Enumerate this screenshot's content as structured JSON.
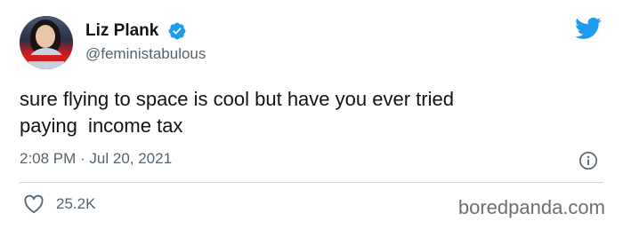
{
  "user": {
    "display_name": "Liz Plank",
    "handle": "@feministabulous",
    "verified_icon": "verified-badge-icon"
  },
  "tweet": {
    "text": "sure flying to space is cool but have you ever tried\npaying  income tax",
    "time": "2:08 PM",
    "separator": " · ",
    "date": "Jul 20, 2021",
    "likes": "25.2K"
  },
  "icons": {
    "logo": "twitter-bird-icon",
    "info": "info-icon",
    "like": "heart-icon"
  },
  "colors": {
    "twitter_blue": "#1d9bf0",
    "text": "#0f1419",
    "secondary": "#536471"
  },
  "watermark": "boredpanda.com"
}
